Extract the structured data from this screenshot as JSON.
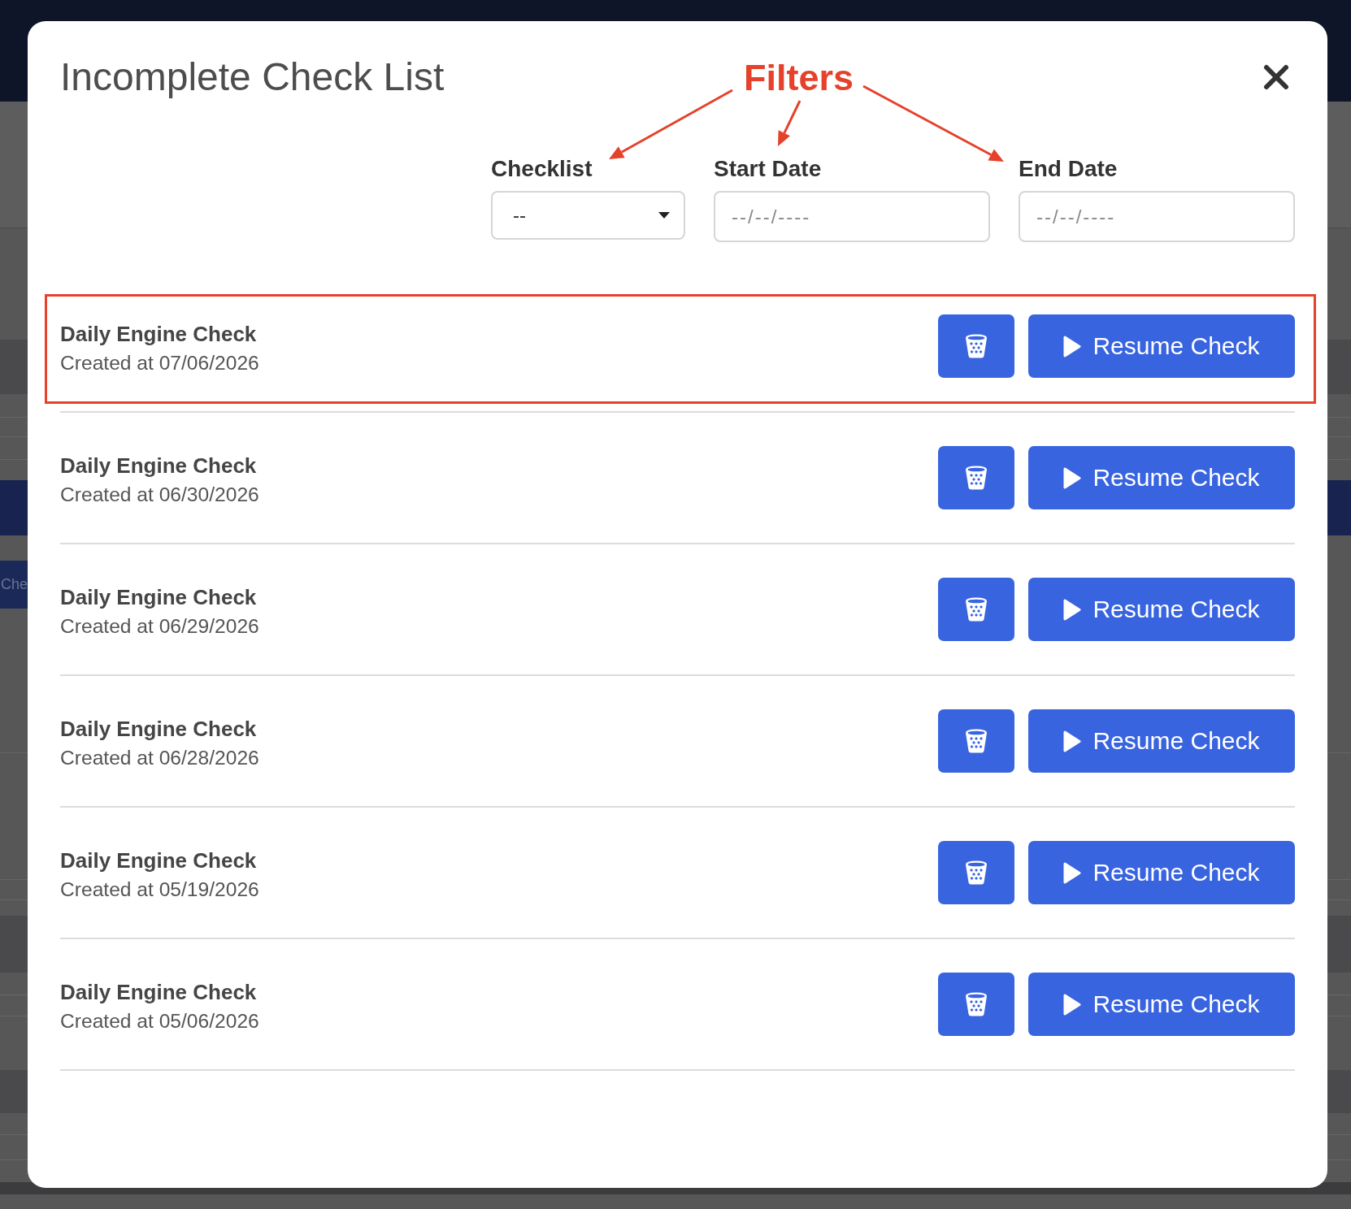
{
  "background": {
    "tab_label": "Che"
  },
  "modal": {
    "title": "Incomplete Check List"
  },
  "annotation": {
    "label": "Filters"
  },
  "filters": [
    {
      "kind": "select",
      "label": "Checklist",
      "value": "--"
    },
    {
      "kind": "date",
      "label": "Start Date",
      "placeholder": "--/--/----"
    },
    {
      "kind": "date",
      "label": "End Date",
      "placeholder": "--/--/----"
    }
  ],
  "rows": [
    {
      "title": "Daily Engine Check",
      "created": "Created at 07/06/2026",
      "highlighted": true,
      "button_label": "Resume Check"
    },
    {
      "title": "Daily Engine Check",
      "created": "Created at 06/30/2026",
      "highlighted": false,
      "button_label": "Resume Check"
    },
    {
      "title": "Daily Engine Check",
      "created": "Created at 06/29/2026",
      "highlighted": false,
      "button_label": "Resume Check"
    },
    {
      "title": "Daily Engine Check",
      "created": "Created at 06/28/2026",
      "highlighted": false,
      "button_label": "Resume Check"
    },
    {
      "title": "Daily Engine Check",
      "created": "Created at 05/19/2026",
      "highlighted": false,
      "button_label": "Resume Check"
    },
    {
      "title": "Daily Engine Check",
      "created": "Created at 05/06/2026",
      "highlighted": false,
      "button_label": "Resume Check"
    }
  ]
}
